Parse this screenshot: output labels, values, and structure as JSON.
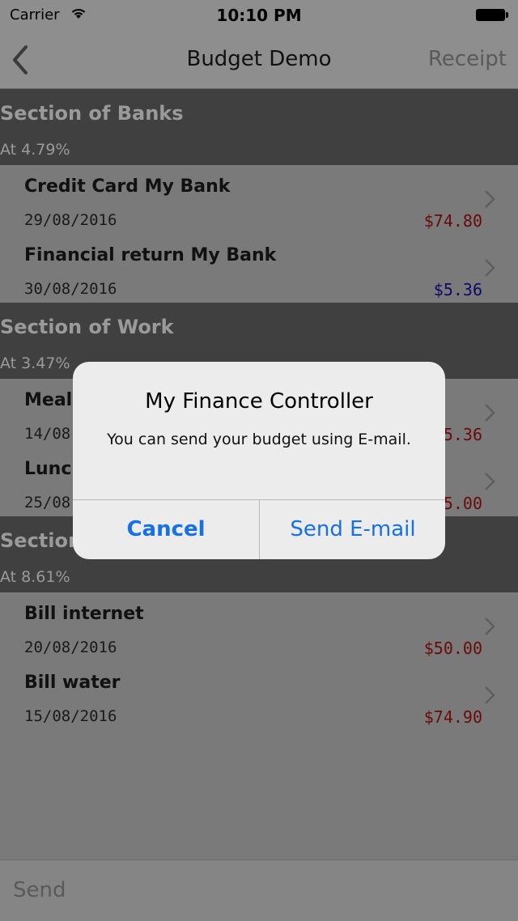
{
  "status_bar": {
    "carrier": "Carrier",
    "time": "10:10 PM"
  },
  "nav_bar": {
    "title": "Budget Demo",
    "right_button": "Receipt"
  },
  "sections": [
    {
      "name": "Section of Banks",
      "rate": "At 4.79%",
      "rows": [
        {
          "label": "Credit Card My Bank",
          "date": "29/08/2016",
          "amount": "$74.80",
          "kind": "neg"
        },
        {
          "label": "Financial return My Bank",
          "date": "30/08/2016",
          "amount": "$5.36",
          "kind": "pos"
        }
      ]
    },
    {
      "name": "Section of Work",
      "rate": "At 3.47%",
      "rows": [
        {
          "label": "Meals",
          "date": "14/08",
          "amount": "5.36",
          "kind": "neg"
        },
        {
          "label": "Lunch",
          "date": "25/08",
          "amount": "5.00",
          "kind": "neg"
        }
      ]
    },
    {
      "name": "Section",
      "rate": "At 8.61%",
      "rows": [
        {
          "label": "Bill internet",
          "date": "20/08/2016",
          "amount": "$50.00",
          "kind": "neg"
        },
        {
          "label": "Bill water",
          "date": "15/08/2016",
          "amount": "$74.90",
          "kind": "neg"
        }
      ]
    }
  ],
  "bottom_bar": {
    "send_label": "Send"
  },
  "alert": {
    "title": "My Finance Controller",
    "message": "You can send your budget using E-mail.",
    "cancel_label": "Cancel",
    "confirm_label": "Send E-mail"
  },
  "colors": {
    "negative_amount": "#6a0a0a",
    "positive_amount": "#0a0a6a",
    "alert_button": "#1670e6"
  },
  "icons": [
    "wifi-icon",
    "battery-icon",
    "back-chevron-icon",
    "chevron-right-icon"
  ]
}
